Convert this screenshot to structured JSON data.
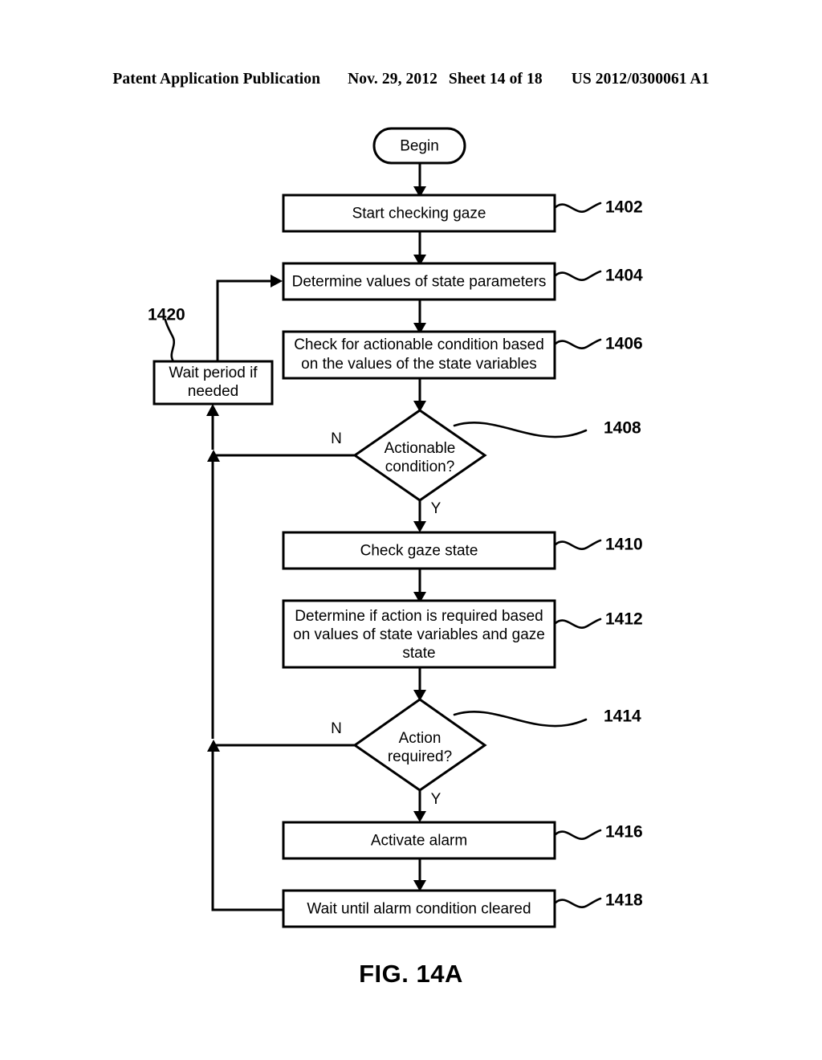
{
  "header": {
    "publication": "Patent Application Publication",
    "date": "Nov. 29, 2012",
    "sheet": "Sheet 14 of 18",
    "pub_number": "US 2012/0300061 A1"
  },
  "figure": {
    "caption": "FIG. 14A"
  },
  "flowchart": {
    "start": {
      "label": "Begin"
    },
    "steps": [
      {
        "ref": "1402",
        "label": "Start checking gaze"
      },
      {
        "ref": "1404",
        "label": "Determine values of state parameters"
      },
      {
        "ref": "1406",
        "label_line1": "Check for actionable condition based",
        "label_line2": "on the values of the state variables"
      },
      {
        "ref": "1408",
        "label_line1": "Actionable",
        "label_line2": "condition?",
        "type": "decision"
      },
      {
        "ref": "1410",
        "label": "Check gaze state"
      },
      {
        "ref": "1412",
        "label_line1": "Determine if action is required based",
        "label_line2": "on values of state variables and gaze",
        "label_line3": "state"
      },
      {
        "ref": "1414",
        "label_line1": "Action",
        "label_line2": "required?",
        "type": "decision"
      },
      {
        "ref": "1416",
        "label": "Activate alarm"
      },
      {
        "ref": "1418",
        "label": "Wait until alarm condition cleared"
      },
      {
        "ref": "1420",
        "label_line1": "Wait period if",
        "label_line2": "needed"
      }
    ],
    "branch_labels": {
      "no_1408": "N",
      "yes_1408": "Y",
      "no_1414": "N",
      "yes_1414": "Y"
    }
  },
  "colors": {
    "ink": "#000000",
    "paper": "#ffffff"
  }
}
